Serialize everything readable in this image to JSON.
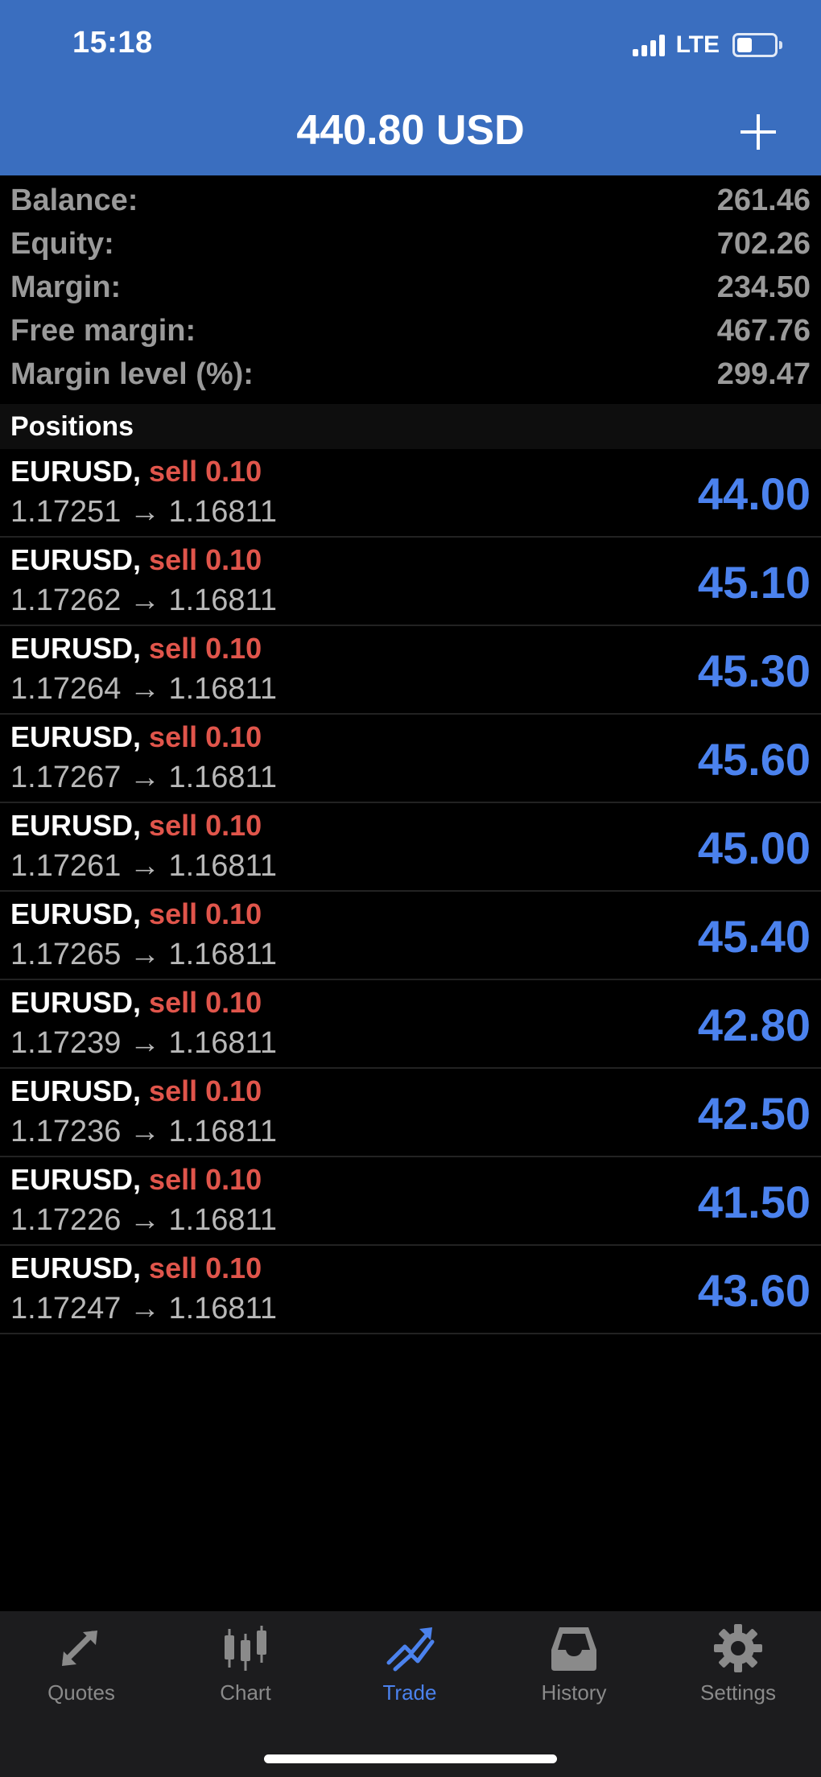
{
  "status_bar": {
    "time": "15:18",
    "network": "LTE"
  },
  "header": {
    "title": "440.80 USD"
  },
  "summary": [
    {
      "label": "Balance:",
      "value": "261.46"
    },
    {
      "label": "Equity:",
      "value": "702.26"
    },
    {
      "label": "Margin:",
      "value": "234.50"
    },
    {
      "label": "Free margin:",
      "value": "467.76"
    },
    {
      "label": "Margin level (%):",
      "value": "299.47"
    }
  ],
  "positions_title": "Positions",
  "positions": [
    {
      "symbol": "EURUSD,",
      "side": "sell 0.10",
      "prices": "1.17251 → 1.16811",
      "profit": "44.00"
    },
    {
      "symbol": "EURUSD,",
      "side": "sell 0.10",
      "prices": "1.17262 → 1.16811",
      "profit": "45.10"
    },
    {
      "symbol": "EURUSD,",
      "side": "sell 0.10",
      "prices": "1.17264 → 1.16811",
      "profit": "45.30"
    },
    {
      "symbol": "EURUSD,",
      "side": "sell 0.10",
      "prices": "1.17267 → 1.16811",
      "profit": "45.60"
    },
    {
      "symbol": "EURUSD,",
      "side": "sell 0.10",
      "prices": "1.17261 → 1.16811",
      "profit": "45.00"
    },
    {
      "symbol": "EURUSD,",
      "side": "sell 0.10",
      "prices": "1.17265 → 1.16811",
      "profit": "45.40"
    },
    {
      "symbol": "EURUSD,",
      "side": "sell 0.10",
      "prices": "1.17239 → 1.16811",
      "profit": "42.80"
    },
    {
      "symbol": "EURUSD,",
      "side": "sell 0.10",
      "prices": "1.17236 → 1.16811",
      "profit": "42.50"
    },
    {
      "symbol": "EURUSD,",
      "side": "sell 0.10",
      "prices": "1.17226 → 1.16811",
      "profit": "41.50"
    },
    {
      "symbol": "EURUSD,",
      "side": "sell 0.10",
      "prices": "1.17247 → 1.16811",
      "profit": "43.60"
    }
  ],
  "tabs": [
    {
      "label": "Quotes",
      "icon": "quotes-arrows-icon",
      "active": false
    },
    {
      "label": "Chart",
      "icon": "candlestick-icon",
      "active": false
    },
    {
      "label": "Trade",
      "icon": "trend-up-icon",
      "active": true
    },
    {
      "label": "History",
      "icon": "inbox-tray-icon",
      "active": false
    },
    {
      "label": "Settings",
      "icon": "gear-icon",
      "active": false
    }
  ],
  "colors": {
    "header_bg": "#3a6ebf",
    "profit_blue": "#4b82ee",
    "sell_red": "#e0554b",
    "tab_inactive": "#8a8a8a"
  }
}
